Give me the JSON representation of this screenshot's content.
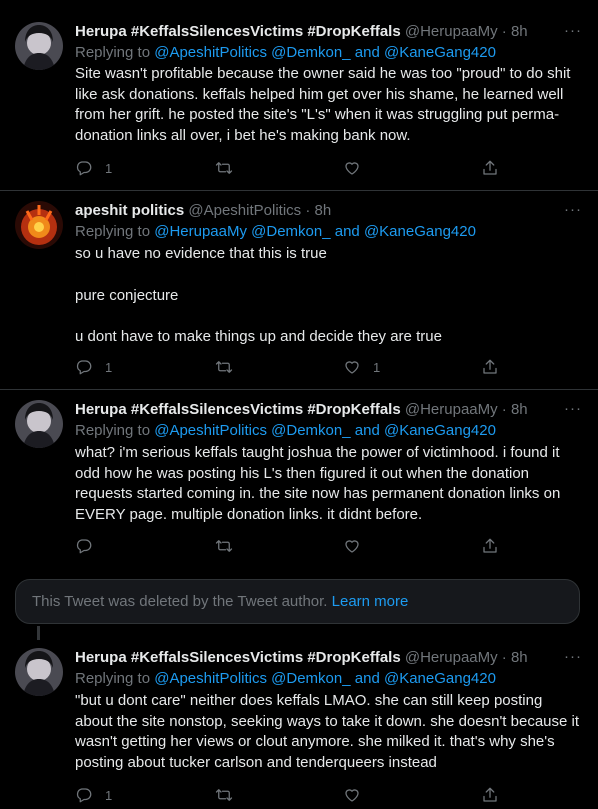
{
  "tweets": [
    {
      "name": "Herupa #KeffalsSilencesVictims #DropKeffals",
      "handle": "@HerupaaMy",
      "time": "· 8h",
      "reply_prefix": "Replying to",
      "reply_users": "@ApeshitPolitics @Demkon_",
      "reply_and": "and",
      "reply_last": "@KaneGang420",
      "lines": [
        "Site wasn't profitable because the owner said he was too \"proud\" to do shit like ask donations. keffals helped him get over his shame, he learned well from her grift. he posted the site's \"L's\" when it was struggling put perma-donation links all over, i bet he's making bank now."
      ],
      "replies": "1",
      "retweets": "",
      "likes": ""
    },
    {
      "name": "apeshit politics",
      "handle": "@ApeshitPolitics",
      "time": "· 8h",
      "reply_prefix": "Replying to",
      "reply_users": "@HerupaaMy @Demkon_",
      "reply_and": "and",
      "reply_last": "@KaneGang420",
      "lines": [
        "so u have no evidence that this is true",
        "pure conjecture",
        "u dont have to make things up and decide they are true"
      ],
      "replies": "1",
      "retweets": "",
      "likes": "1"
    },
    {
      "name": "Herupa #KeffalsSilencesVictims #DropKeffals",
      "handle": "@HerupaaMy",
      "time": "· 8h",
      "reply_prefix": "Replying to",
      "reply_users": "@ApeshitPolitics @Demkon_",
      "reply_and": "and",
      "reply_last": "@KaneGang420",
      "lines": [
        "what? i'm serious keffals taught joshua the power of victimhood. i found it odd how he was posting his L's then figured it out when the donation requests started coming in. the site now has permanent donation links on EVERY page. multiple donation links. it didnt before."
      ],
      "replies": "",
      "retweets": "",
      "likes": ""
    },
    {
      "name": "Herupa #KeffalsSilencesVictims #DropKeffals",
      "handle": "@HerupaaMy",
      "time": "· 8h",
      "reply_prefix": "Replying to",
      "reply_users": "@ApeshitPolitics @Demkon_",
      "reply_and": "and",
      "reply_last": "@KaneGang420",
      "lines": [
        "\"but u dont care\" neither does keffals LMAO. she can still keep posting about the site nonstop, seeking ways to take it down. she doesn't because it wasn't getting her views or clout anymore. she milked it. that's why she's posting about tucker carlson and tenderqueers instead"
      ],
      "replies": "1",
      "retweets": "",
      "likes": ""
    }
  ],
  "deleted_notice": {
    "text": "This Tweet was deleted by the Tweet author.",
    "link": "Learn more"
  },
  "more_icon_text": "···",
  "colors": {
    "background": "#000000",
    "text": "#e7e9ea",
    "muted": "#71767b",
    "link": "#1d9bf0",
    "border": "#2f3336"
  },
  "icons": [
    "reply-icon",
    "retweet-icon",
    "like-icon",
    "share-icon",
    "more-icon",
    "avatar-herupa",
    "avatar-apeshit"
  ]
}
